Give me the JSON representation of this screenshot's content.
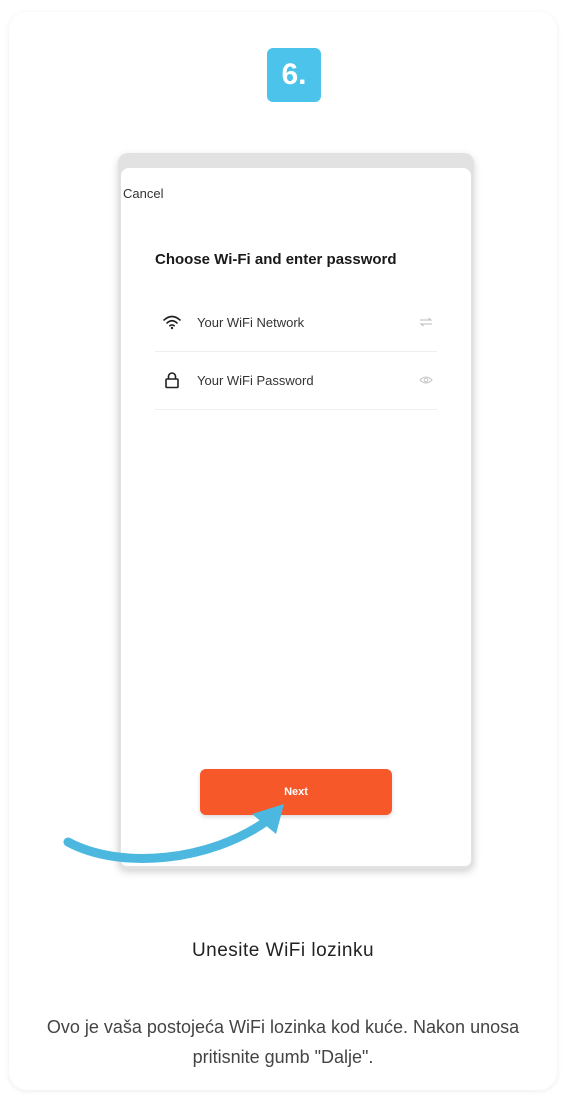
{
  "step": {
    "badge": "6."
  },
  "wifi_screen": {
    "cancel_label": "Cancel",
    "title": "Choose Wi-Fi and enter password",
    "network_field": {
      "value": "Your WiFi Network",
      "icon": "wifi-icon",
      "trailing_icon": "switch-network-icon"
    },
    "password_field": {
      "value": "Your WiFi Password",
      "icon": "lock-icon",
      "trailing_icon": "eye-icon"
    },
    "next_label": "Next"
  },
  "caption": {
    "title": "Unesite WiFi lozinku",
    "body": "Ovo je vaša postojeća WiFi lozinka kod kuće. Nakon unosa pritisnite gumb \"Dalje\"."
  },
  "colors": {
    "badge": "#4cc3ea",
    "next_button": "#f7582a",
    "arrow": "#4cb8df"
  }
}
